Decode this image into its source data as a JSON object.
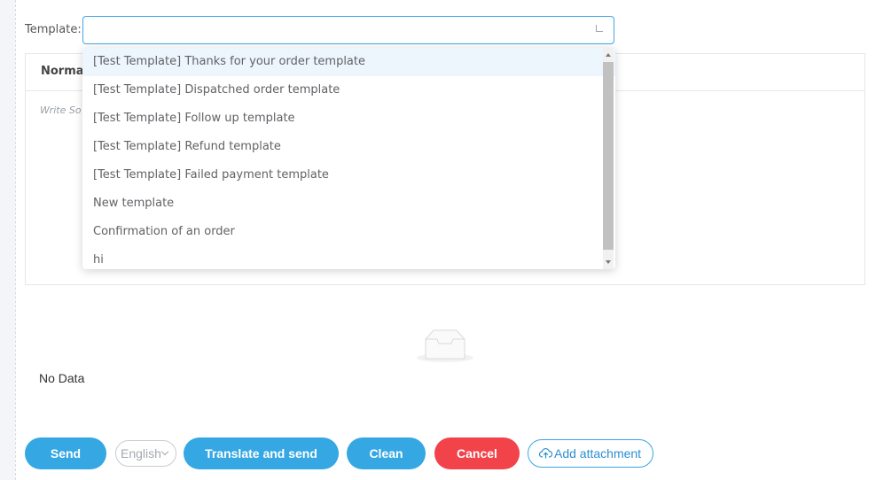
{
  "template_field": {
    "label": "Template:",
    "value": "",
    "options": [
      "[Test Template] Thanks for your order template",
      "[Test Template] Dispatched order template",
      "[Test Template] Follow up template",
      "[Test Template] Refund template",
      "[Test Template] Failed payment template",
      "New template",
      "Confirmation of an order",
      "hi"
    ],
    "highlighted_index": 0
  },
  "editor": {
    "format_label": "Normal",
    "placeholder": "Write So"
  },
  "attachments": {
    "empty_text": "No Data",
    "icon": "empty-inbox-icon"
  },
  "actions": {
    "send_label": "Send",
    "language_value": "English",
    "translate_label": "Translate and send",
    "clean_label": "Clean",
    "cancel_label": "Cancel",
    "attach_label": "Add attachment",
    "attach_icon": "cloud-upload-icon"
  },
  "colors": {
    "primary": "#35a7e3",
    "danger": "#f2434b",
    "focus_border": "#42a5e6"
  }
}
